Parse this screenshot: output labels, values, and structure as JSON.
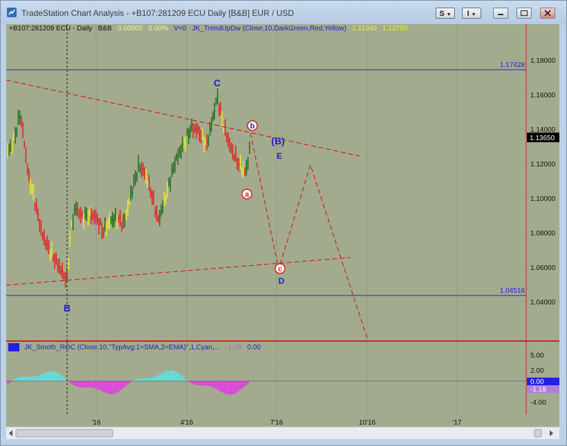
{
  "window": {
    "title": "TradeStation Chart Analysis - +B107:281209 ECU Daily [B&B] EUR / USD",
    "btn_s": "S",
    "btn_i": "I"
  },
  "legend": {
    "symbol": "+B107:281209 ECU - Daily",
    "bb": "B&B",
    "change": "0.00000",
    "pct": "0.00%",
    "volume": "V=0",
    "study": "JK_TrendUpDw (Close,10,DarkGreen,Red,Yellow)",
    "val1": "1.11340",
    "val2": "1.13750"
  },
  "osc_legend": {
    "study": "JK_Smoth_ROC (Close,10,\"TypAvg:1=SMA,2=EMA)\",1,Cyan,...",
    "val1": "-1.18",
    "val2": "0.00"
  },
  "price_axis": [
    "1.18000",
    "1.16000",
    "1.14000",
    "1.12000",
    "1.10000",
    "1.08000",
    "1.06000",
    "1.04000"
  ],
  "price_flags": {
    "upper_line": "1.17428",
    "lower_line": "1.04516",
    "last_price": "1.13650"
  },
  "osc_axis": [
    "5.00",
    "2.00",
    "-4.00"
  ],
  "osc_flags": {
    "zero": "0.00",
    "value": "-1.18"
  },
  "time_axis": [
    "'16",
    "4'16",
    "7'16",
    "10'16",
    "'17"
  ],
  "wave_labels": {
    "B": "B",
    "C": "C",
    "b": "b",
    "B_paren": "(B)",
    "E": "E",
    "a": "a",
    "c": "c",
    "D": "D"
  },
  "colors": {
    "background": "#a3ab8e",
    "up_bar": "#1d6b1d",
    "down_bar": "#e02020",
    "neutral_bar": "#ecec20",
    "line_blue": "#2020d0",
    "trend_red": "#d02020",
    "osc_cyan": "#5fe0e0",
    "osc_magenta": "#e040e0"
  }
}
